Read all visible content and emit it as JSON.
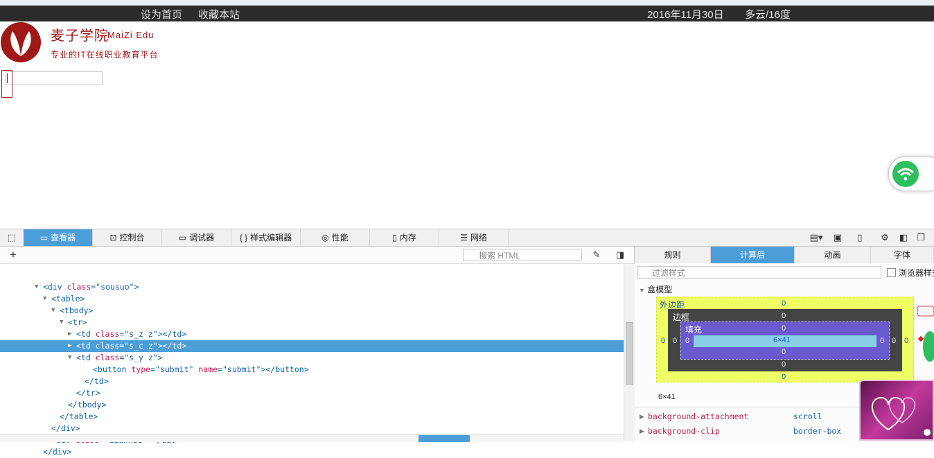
{
  "site": {
    "set_home": "设为首页",
    "bookmark": "收藏本站",
    "date": "2016年11月30日",
    "weather": "多云/16度",
    "brand_cn": "麦子学院",
    "brand_en": "MaiZi Edu",
    "slogan": "专业的IT在线职业教育平台",
    "brand_color": "#a01818"
  },
  "devtools": {
    "tabs": [
      {
        "label": "查看器",
        "icon": "inspector-icon"
      },
      {
        "label": "控制台",
        "icon": "console-icon"
      },
      {
        "label": "调试器",
        "icon": "debugger-icon"
      },
      {
        "label": "样式编辑器",
        "icon": "style-editor-icon"
      },
      {
        "label": "性能",
        "icon": "performance-icon"
      },
      {
        "label": "内存",
        "icon": "memory-icon"
      },
      {
        "label": "网络",
        "icon": "network-icon"
      }
    ],
    "active_tab": "查看器",
    "accent_color": "#4c9ed9",
    "search_placeholder": "搜索 HTML",
    "markup": [
      {
        "text": "<div class=\"sousuo\">"
      },
      {
        "text": "<table>"
      },
      {
        "text": "<tbody>"
      },
      {
        "text": "<tr>"
      },
      {
        "text": "<td class=\"s_z z\"></td>"
      },
      {
        "text": "<td class=\"s_c z\"></td>"
      },
      {
        "text": "<td class=\"s_y z\">"
      },
      {
        "text": "<button type=\"submit\" name=\"submit\"></button>"
      },
      {
        "text": "</td>"
      },
      {
        "text": "</tr>"
      },
      {
        "text": "</tbody>"
      },
      {
        "text": "</table>"
      },
      {
        "text": "</div>"
      },
      {
        "text": "<div class=\"dianhua\"></div>"
      },
      {
        "text": "</div>"
      }
    ],
    "selected_line": "<td class=\"s_c z\"></td>",
    "side_tabs": [
      "规则",
      "计算后",
      "动画",
      "字体"
    ],
    "side_active": "计算后",
    "filter_placeholder": "过滤样式",
    "browser_styles_label": "浏览器样式",
    "box_model": {
      "heading": "盒模型",
      "margin_label": "外边距",
      "border_label": "边框",
      "padding_label": "填充",
      "margin": [
        "0",
        "0",
        "0",
        "0"
      ],
      "border": [
        "0",
        "0",
        "0",
        "0"
      ],
      "padding": [
        "0",
        "0",
        "0",
        "0"
      ],
      "content": "6×41",
      "size": "6×41"
    },
    "properties": [
      {
        "name": "background-attachment",
        "value": "scroll"
      },
      {
        "name": "background-clip",
        "value": "border-box"
      }
    ]
  }
}
